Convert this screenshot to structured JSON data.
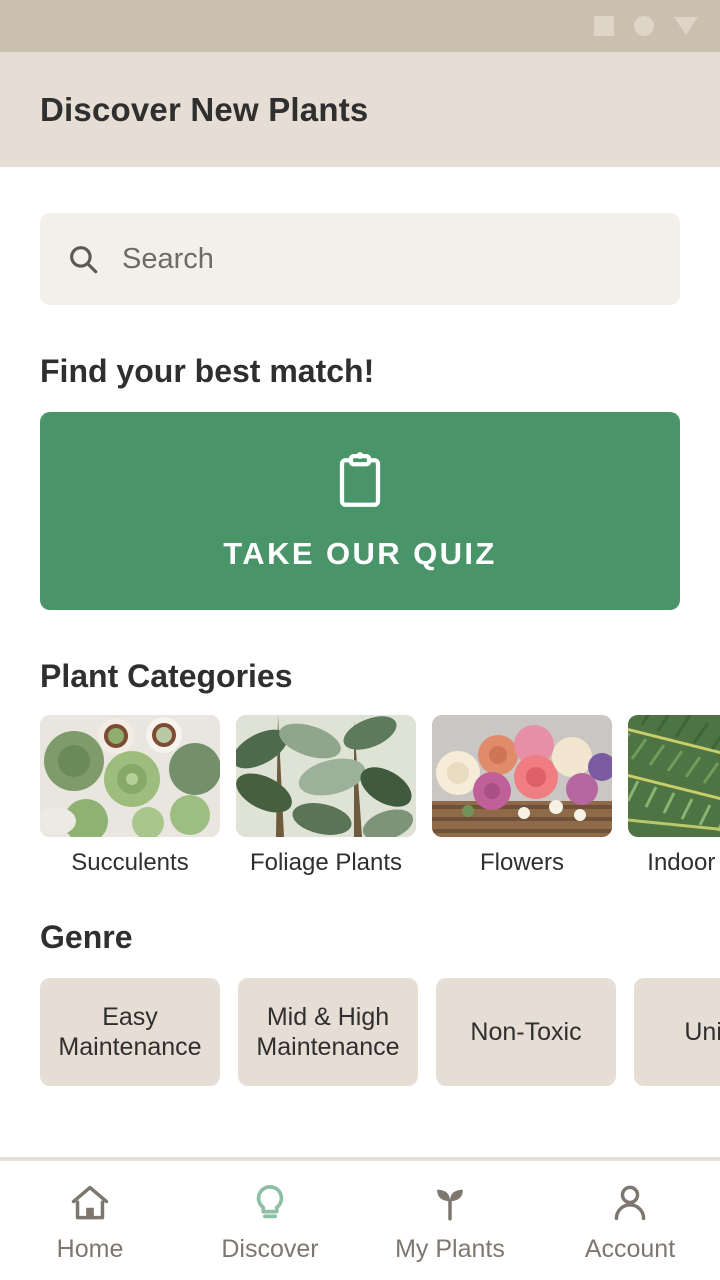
{
  "status_bar": {
    "icons": [
      "square-icon",
      "circle-icon",
      "triangle-down-icon"
    ],
    "background": "#cbbfb0",
    "icon_color": "#ded4c8"
  },
  "app_bar": {
    "title": "Discover New Plants",
    "background": "#e6ddd4",
    "title_color": "#2f2f2f"
  },
  "search": {
    "icon": "search-icon",
    "placeholder": "Search",
    "value": "",
    "background": "#f3efe9"
  },
  "quiz": {
    "heading": "Find your best match!",
    "icon": "clipboard-icon",
    "button_label": "TAKE OUR QUIZ",
    "accent_color": "#4a946a",
    "label_color": "#ffffff"
  },
  "categories": {
    "heading": "Plant Categories",
    "items": [
      {
        "label": "Succulents",
        "image": "succulents-photo"
      },
      {
        "label": "Foliage Plants",
        "image": "foliage-plants-photo"
      },
      {
        "label": "Flowers",
        "image": "flowers-photo"
      },
      {
        "label": "Indoor Plants",
        "image": "indoor-plants-photo"
      }
    ]
  },
  "genre": {
    "heading": "Genre",
    "chip_color": "#e6ddd4",
    "items": [
      {
        "label": "Easy Maintenance"
      },
      {
        "label": "Mid & High Maintenance"
      },
      {
        "label": "Non-Toxic"
      },
      {
        "label": "Unique"
      }
    ]
  },
  "bottom_nav": {
    "active_color": "#8cbfa3",
    "inactive_color": "#7d7770",
    "items": [
      {
        "label": "Home",
        "icon": "home-icon",
        "active": false
      },
      {
        "label": "Discover",
        "icon": "lightbulb-icon",
        "active": true
      },
      {
        "label": "My Plants",
        "icon": "seedling-icon",
        "active": false
      },
      {
        "label": "Account",
        "icon": "person-icon",
        "active": false
      }
    ]
  }
}
